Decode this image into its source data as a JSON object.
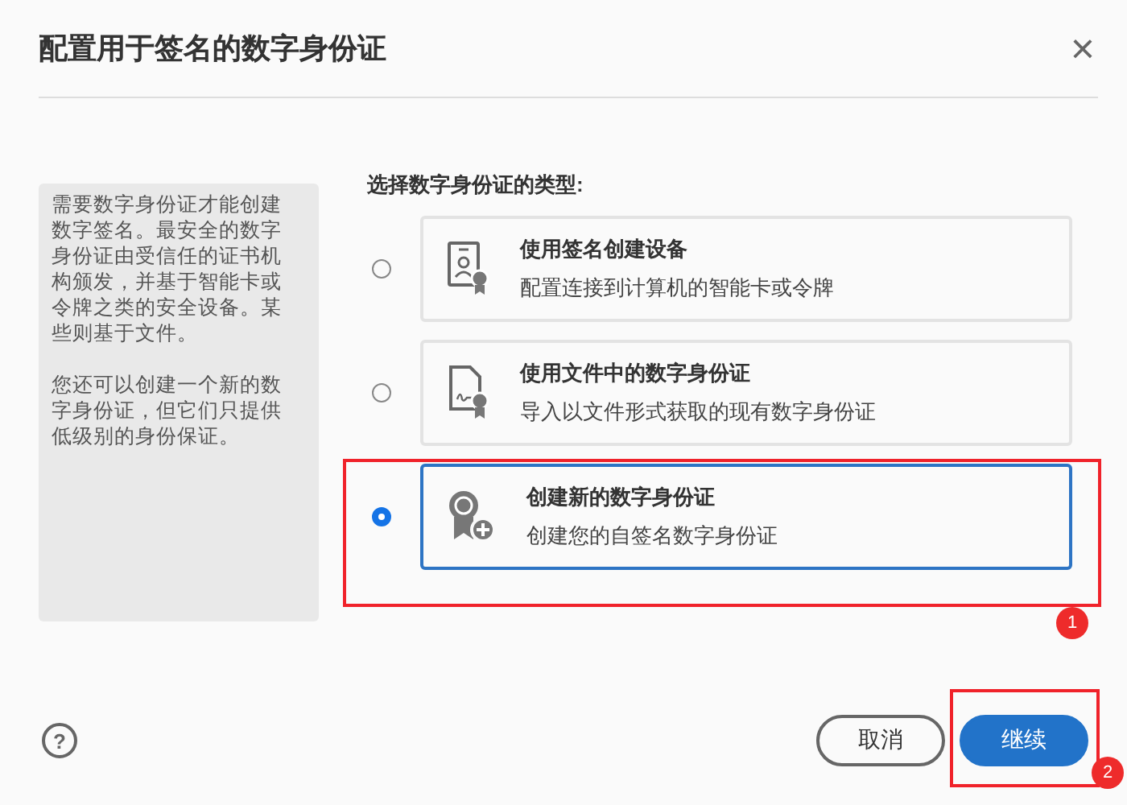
{
  "dialog": {
    "title": "配置用于签名的数字身份证",
    "close": "×"
  },
  "info_panel": {
    "paragraphs": [
      "需要数字身份证才能创建数字签名。最安全的数字身份证由受信任的证书机构颁发，并基于智能卡或令牌之类的安全设备。某些则基于文件。",
      "您还可以创建一个新的数字身份证，但它们只提供低级别的身份保证。"
    ]
  },
  "options_label": "选择数字身份证的类型:",
  "options": [
    {
      "kind": "device",
      "title": "使用签名创建设备",
      "description": "配置连接到计算机的智能卡或令牌",
      "selected": false
    },
    {
      "kind": "file",
      "title": "使用文件中的数字身份证",
      "description": "导入以文件形式获取的现有数字身份证",
      "selected": false
    },
    {
      "kind": "create",
      "title": "创建新的数字身份证",
      "description": "创建您的自签名数字身份证",
      "selected": true
    }
  ],
  "footer": {
    "help": "?",
    "buttons": [
      {
        "kind": "secondary",
        "label": "取消"
      },
      {
        "kind": "primary",
        "label": "继续"
      }
    ]
  },
  "annotations": [
    {
      "kind": "option",
      "label": "1"
    },
    {
      "kind": "button",
      "label": "2"
    }
  ]
}
